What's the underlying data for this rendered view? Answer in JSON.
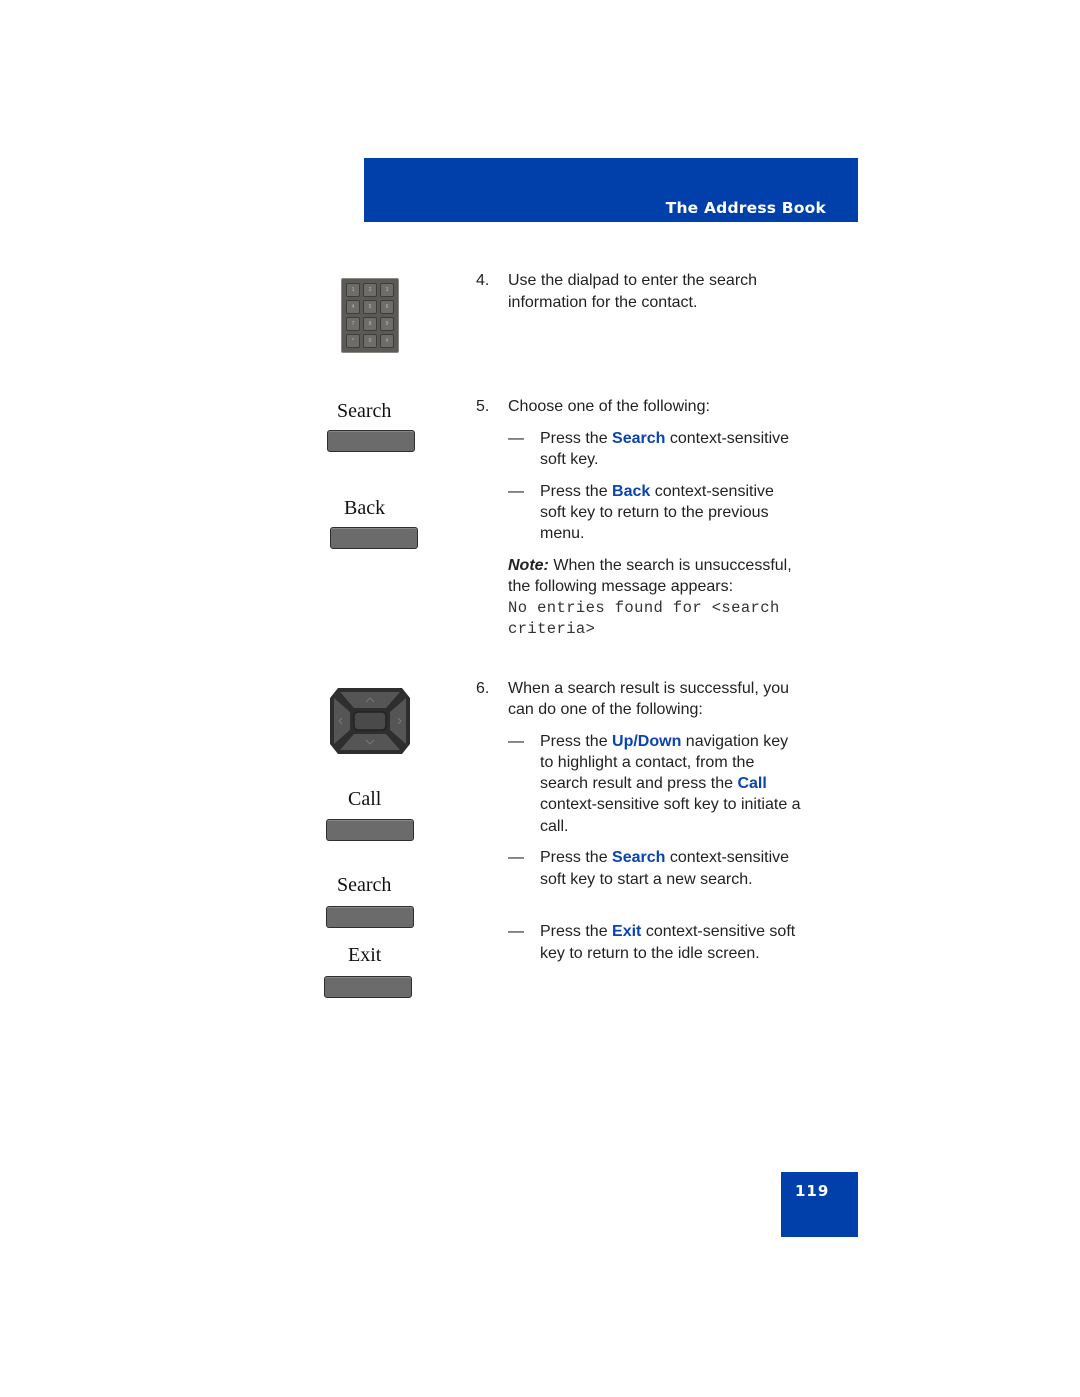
{
  "header": {
    "title": "The Address Book",
    "color": "#0140ab"
  },
  "page_number": "119",
  "left_column": {
    "dialpad": {
      "icon": "dialpad-icon",
      "keys": [
        "1",
        "2",
        "3",
        "4",
        "5",
        "6",
        "7",
        "8",
        "9",
        "*",
        "0",
        "#"
      ]
    },
    "softkeys_group1": [
      {
        "label": "Search"
      },
      {
        "label": "Back"
      }
    ],
    "navigation_key": {
      "icon": "navigation-cluster-icon"
    },
    "softkeys_group2": [
      {
        "label": "Call"
      },
      {
        "label": "Search"
      },
      {
        "label": "Exit"
      }
    ]
  },
  "steps": {
    "step4": {
      "number": "4.",
      "line1": "Use the dialpad to enter the search",
      "line2": "information for the contact."
    },
    "step5": {
      "number": "5.",
      "intro": "Choose one of the following:",
      "bullets": [
        {
          "dash": "—",
          "pre": "Press the ",
          "keyword": "Search",
          "post": " context-sensitive",
          "line2": "soft key."
        },
        {
          "dash": "—",
          "pre": "Press the ",
          "keyword": "Back",
          "post": " context-sensitive",
          "line2": "soft key to return to the previous",
          "line3": "menu."
        }
      ],
      "note": {
        "label": "Note:",
        "line1": " When the search is unsuccessful,",
        "line2": "the following message appears:",
        "message_line1": "No entries found for <search",
        "message_line2": "criteria>"
      }
    },
    "step6": {
      "number": "6.",
      "line1": "When a search result is successful, you",
      "line2": "can do one of the following:",
      "bullets": [
        {
          "dash": "—",
          "pre": "Press the ",
          "keyword": "Up/Down",
          "post": " navigation key",
          "line2": "to highlight a contact, from the",
          "line3_pre": "search result and press the ",
          "line3_keyword": "Call",
          "line4": "context-sensitive soft key to initiate a",
          "line5": "call."
        },
        {
          "dash": "—",
          "pre": "Press the ",
          "keyword": "Search",
          "post": " context-sensitive",
          "line2": "soft key to start a new search."
        },
        {
          "dash": "—",
          "pre": "Press the ",
          "keyword": "Exit",
          "post": " context-sensitive soft",
          "line2": "key to return to the idle screen."
        }
      ]
    }
  },
  "colors": {
    "keyword": "#0a44b0",
    "brand": "#0140ab",
    "softkey": "#6b6b6b"
  }
}
